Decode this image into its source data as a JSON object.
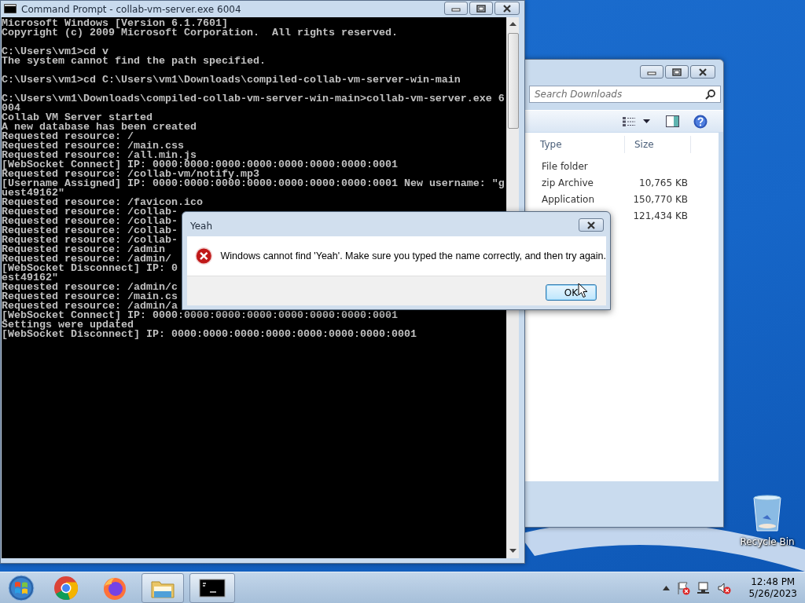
{
  "console_window": {
    "title": "Command Prompt - collab-vm-server.exe  6004",
    "blocks": [
      [
        "Microsoft Windows [Version 6.1.7601]",
        "Copyright (c) 2009 Microsoft Corporation.  All rights reserved."
      ],
      [
        "C:\\Users\\vm1>cd v",
        "The system cannot find the path specified."
      ],
      [
        "C:\\Users\\vm1>cd C:\\Users\\vm1\\Downloads\\compiled-collab-vm-server-win-main"
      ],
      [
        "C:\\Users\\vm1\\Downloads\\compiled-collab-vm-server-win-main>collab-vm-server.exe 6",
        "004",
        "Collab VM Server started",
        "A new database has been created",
        "Requested resource: /",
        "Requested resource: /main.css",
        "Requested resource: /all.min.js",
        "[WebSocket Connect] IP: 0000:0000:0000:0000:0000:0000:0000:0001",
        "Requested resource: /collab-vm/notify.mp3",
        "[Username Assigned] IP: 0000:0000:0000:0000:0000:0000:0000:0001 New username: \"g",
        "uest49162\"",
        "Requested resource: /favicon.ico",
        "Requested resource: /collab-",
        "Requested resource: /collab-",
        "Requested resource: /collab-",
        "Requested resource: /collab-",
        "Requested resource: /admin",
        "Requested resource: /admin/",
        "[WebSocket Disconnect] IP: 0",
        "est49162\"",
        "Requested resource: /admin/c",
        "Requested resource: /main.cs",
        "Requested resource: /admin/a",
        "[WebSocket Connect] IP: 0000:0000:0000:0000:0000:0000:0000:0001",
        "Settings were updated",
        "[WebSocket Disconnect] IP: 0000:0000:0000:0000:0000:0000:0000:0001"
      ]
    ]
  },
  "explorer_window": {
    "search": {
      "placeholder": "Search Downloads"
    },
    "columns": [
      "Type",
      "Size"
    ],
    "rows": [
      {
        "type": "File folder"
      },
      {
        "type": "zip Archive",
        "size": "10,765 KB"
      },
      {
        "type": "Application",
        "size": "150,770 KB"
      },
      {
        "size": "121,434 KB"
      }
    ]
  },
  "dialog": {
    "title": "Yeah",
    "message": "Windows cannot find 'Yeah'. Make sure you typed the name correctly, and then try again.",
    "button": "OK"
  },
  "desktop_icons": [
    {
      "label": "Recycle Bin"
    }
  ],
  "taskbar": {
    "items": [
      {
        "kind": "start",
        "running": false
      },
      {
        "kind": "chrome",
        "running": false
      },
      {
        "kind": "firefox",
        "running": false
      },
      {
        "kind": "folder",
        "running": true
      },
      {
        "kind": "console",
        "running": true
      }
    ],
    "clock": {
      "time": "12:48 PM",
      "date": "5/26/2023"
    }
  }
}
